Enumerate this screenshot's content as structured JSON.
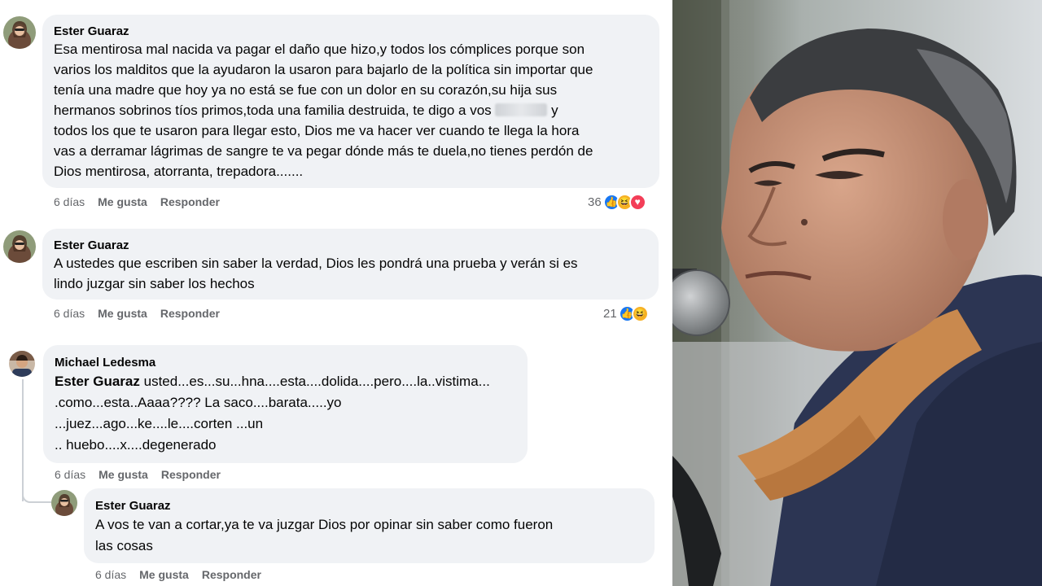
{
  "comments": [
    {
      "name": "Ester Guaraz",
      "lines": [
        "Esa mentirosa mal nacida va pagar el daño que hizo,y todos los cómplices porque son",
        "varios los malditos que la ayudaron la usaron para bajarlo de la política sin importar que",
        "tenía una madre que hoy ya no está se fue con un dolor en su corazón,su hija sus",
        "hermanos sobrinos tíos primos,toda una familia destruida, te digo a vos",
        "todos los que te usaron para llegar esto, Dios me va hacer ver cuando te llega la hora",
        "vas a derramar lágrimas de sangre te va pegar dónde más te duela,no tienes perdón de",
        "Dios mentirosa, atorranta, trepadora......."
      ],
      "line4_tail": "y",
      "time": "6 días",
      "like_label": "Me gusta",
      "reply_label": "Responder",
      "reaction_count": "36"
    },
    {
      "name": "Ester Guaraz",
      "lines": [
        "A ustedes que escriben sin saber la verdad, Dios les pondrá una prueba y verán si es",
        "lindo juzgar sin saber los hechos"
      ],
      "time": "6 días",
      "like_label": "Me gusta",
      "reply_label": "Responder",
      "reaction_count": "21"
    },
    {
      "name": "Michael Ledesma",
      "tag": "Ester Guaraz",
      "line1_rest": " usted...es...su...hna....esta....dolida....pero....la..vistima...",
      "lines": [
        ".como...esta..Aaaa???? La saco....barata.....yo",
        "...juez...ago...ke....le....corten ...un",
        ".. huebo....x....degenerado"
      ],
      "time": "6 días",
      "like_label": "Me gusta",
      "reply_label": "Responder"
    },
    {
      "name": "Ester Guaraz",
      "lines": [
        "A vos te van a cortar,ya te va juzgar Dios por opinar sin saber como fueron",
        "las cosas"
      ],
      "time": "6 días",
      "like_label": "Me gusta",
      "reply_label": "Responder"
    }
  ],
  "icons": {
    "like": "thumbs-up-icon",
    "haha": "laughing-face-icon",
    "love": "heart-icon"
  },
  "colors": {
    "bubble": "#f0f2f5",
    "meta": "#65676b",
    "like": "#1877f2",
    "haha": "#f7b125",
    "love": "#f33e58"
  }
}
